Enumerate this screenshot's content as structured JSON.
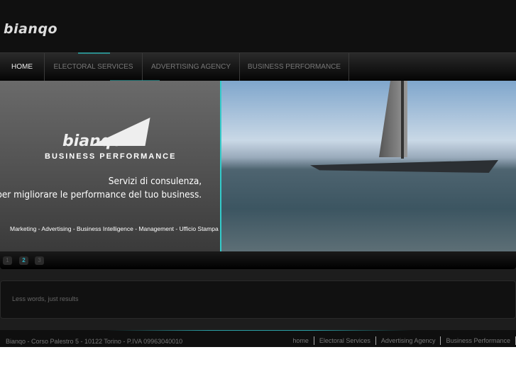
{
  "header": {
    "logo": "bianqo"
  },
  "nav": {
    "items": [
      {
        "label": "HOME",
        "active": true
      },
      {
        "label": "ELECTORAL SERVICES"
      },
      {
        "label": "ADVERTISING AGENCY"
      },
      {
        "label": "BUSINESS PERFORMANCE"
      }
    ]
  },
  "slide": {
    "logo": "bianqo",
    "subtitle": "BUSINESS PERFORMANCE",
    "tagline": [
      "Servizi di consulenza,",
      "per migliorare le performance del tuo business."
    ],
    "services": "Marketing - Advertising - Business Intelligence - Management -  Ufficio Stampa"
  },
  "pager": {
    "pages": [
      "1",
      "2",
      "3"
    ],
    "active": "2"
  },
  "box": {
    "text": "Less words, just results"
  },
  "footer": {
    "address": "Bianqo - Corso Palestro 5 - 10122 Torino - P.IVA 09963040010",
    "links": [
      "home",
      "Electoral Services",
      "Advertising Agency",
      "Business Performance"
    ]
  },
  "colors": {
    "accent": "#2bb5c5"
  }
}
